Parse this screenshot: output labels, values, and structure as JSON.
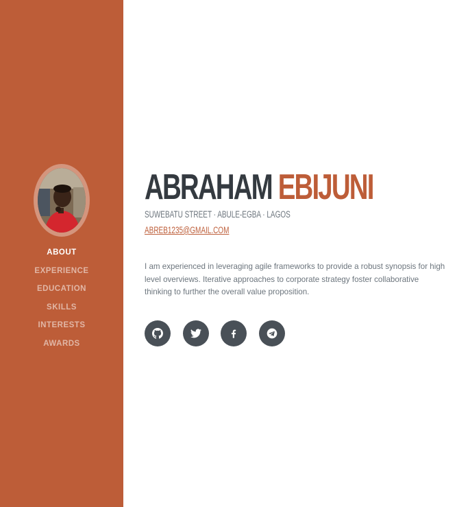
{
  "sidebar": {
    "nav": [
      {
        "label": "ABOUT",
        "active": true
      },
      {
        "label": "EXPERIENCE",
        "active": false
      },
      {
        "label": "EDUCATION",
        "active": false
      },
      {
        "label": "SKILLS",
        "active": false
      },
      {
        "label": "INTERESTS",
        "active": false
      },
      {
        "label": "AWARDS",
        "active": false
      }
    ]
  },
  "about": {
    "first_name": "ABRAHAM",
    "last_name": "EBIJUNI",
    "address": "SUWEBATU STREET · ABULE-EGBA · LAGOS",
    "email": "ABREB1235@GMAIL.COM",
    "lead": "I am experienced in leveraging agile frameworks to provide a robust synopsis for high level overviews. Iterative approaches to corporate strategy foster collaborative thinking to further the overall value proposition."
  },
  "social": [
    {
      "icon": "github-icon"
    },
    {
      "icon": "twitter-icon"
    },
    {
      "icon": "facebook-icon"
    },
    {
      "icon": "telegram-icon"
    }
  ],
  "colors": {
    "primary": "#bd5d38",
    "heading": "#343a40",
    "muted": "#6c757d",
    "social_bg": "#495057"
  }
}
